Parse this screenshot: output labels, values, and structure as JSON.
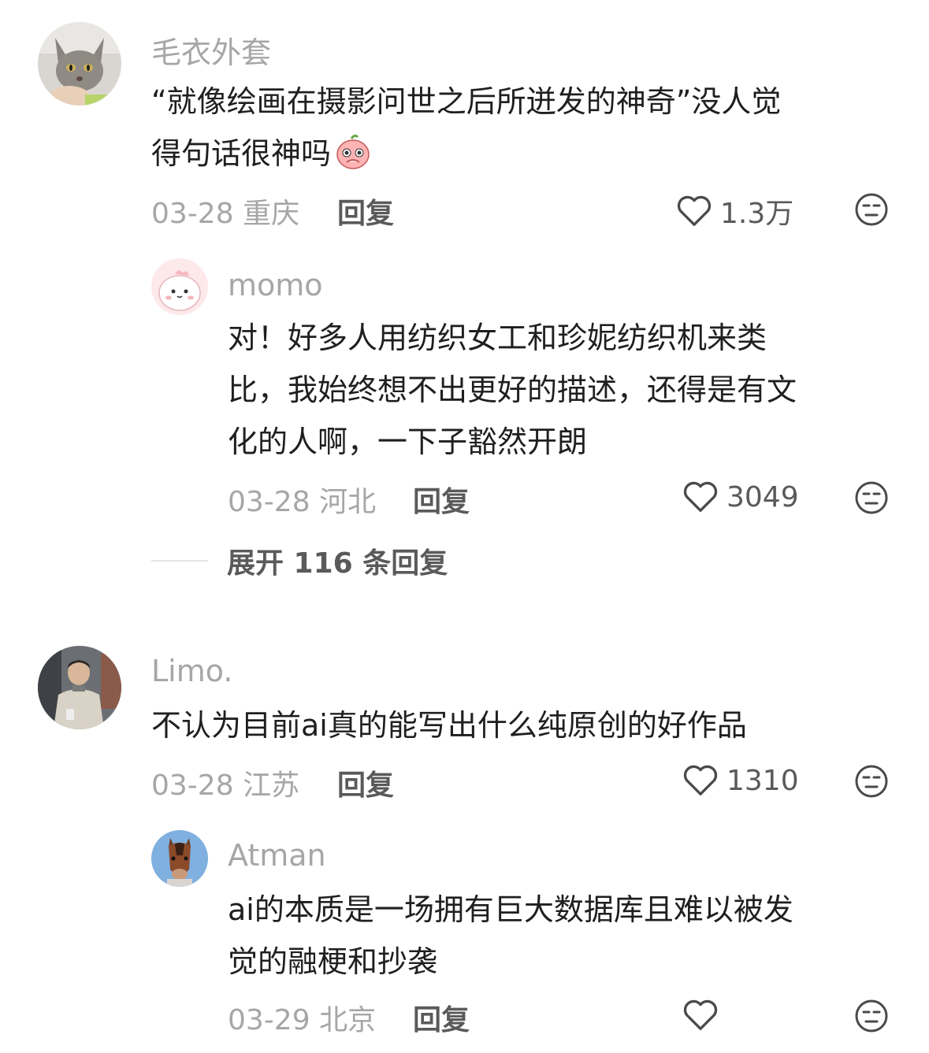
{
  "comments": [
    {
      "username": "毛衣外套",
      "content_lines": [
        "“就像绘画在摄影问世之后所迸发的神奇”没人觉",
        "得句话很神吗"
      ],
      "date": "03-28",
      "location": "重庆",
      "reply_label": "回复",
      "likes": "1.3万",
      "avatar_icon": "cat-avatar-icon"
    },
    {
      "username": "momo",
      "content_lines": [
        "对！好多人用纺织女工和珍妮纺织机来类",
        "比，我始终想不出更好的描述，还得是有文",
        "化的人啊，一下子豁然开朗"
      ],
      "date": "03-28",
      "location": "河北",
      "reply_label": "回复",
      "likes": "3049",
      "avatar_icon": "cartoon-pink-avatar-icon"
    },
    {
      "username": "Limo.",
      "content_lines": [
        "不认为目前ai真的能写出什么纯原创的好作品"
      ],
      "date": "03-28",
      "location": "江苏",
      "reply_label": "回复",
      "likes": "1310",
      "avatar_icon": "person-avatar-icon"
    },
    {
      "username": "Atman",
      "content_lines": [
        "ai的本质是一场拥有巨大数据库且难以被发",
        "觉的融梗和抄袭"
      ],
      "date": "03-29",
      "location": "北京",
      "reply_label": "回复",
      "likes": "",
      "avatar_icon": "horse-avatar-icon"
    }
  ],
  "expand_replies": "展开 116 条回复",
  "colors": {
    "username": "#a6a6a6",
    "text": "#1f1f1f",
    "meta": "#a6a6a6",
    "action": "#5a5a5a"
  }
}
